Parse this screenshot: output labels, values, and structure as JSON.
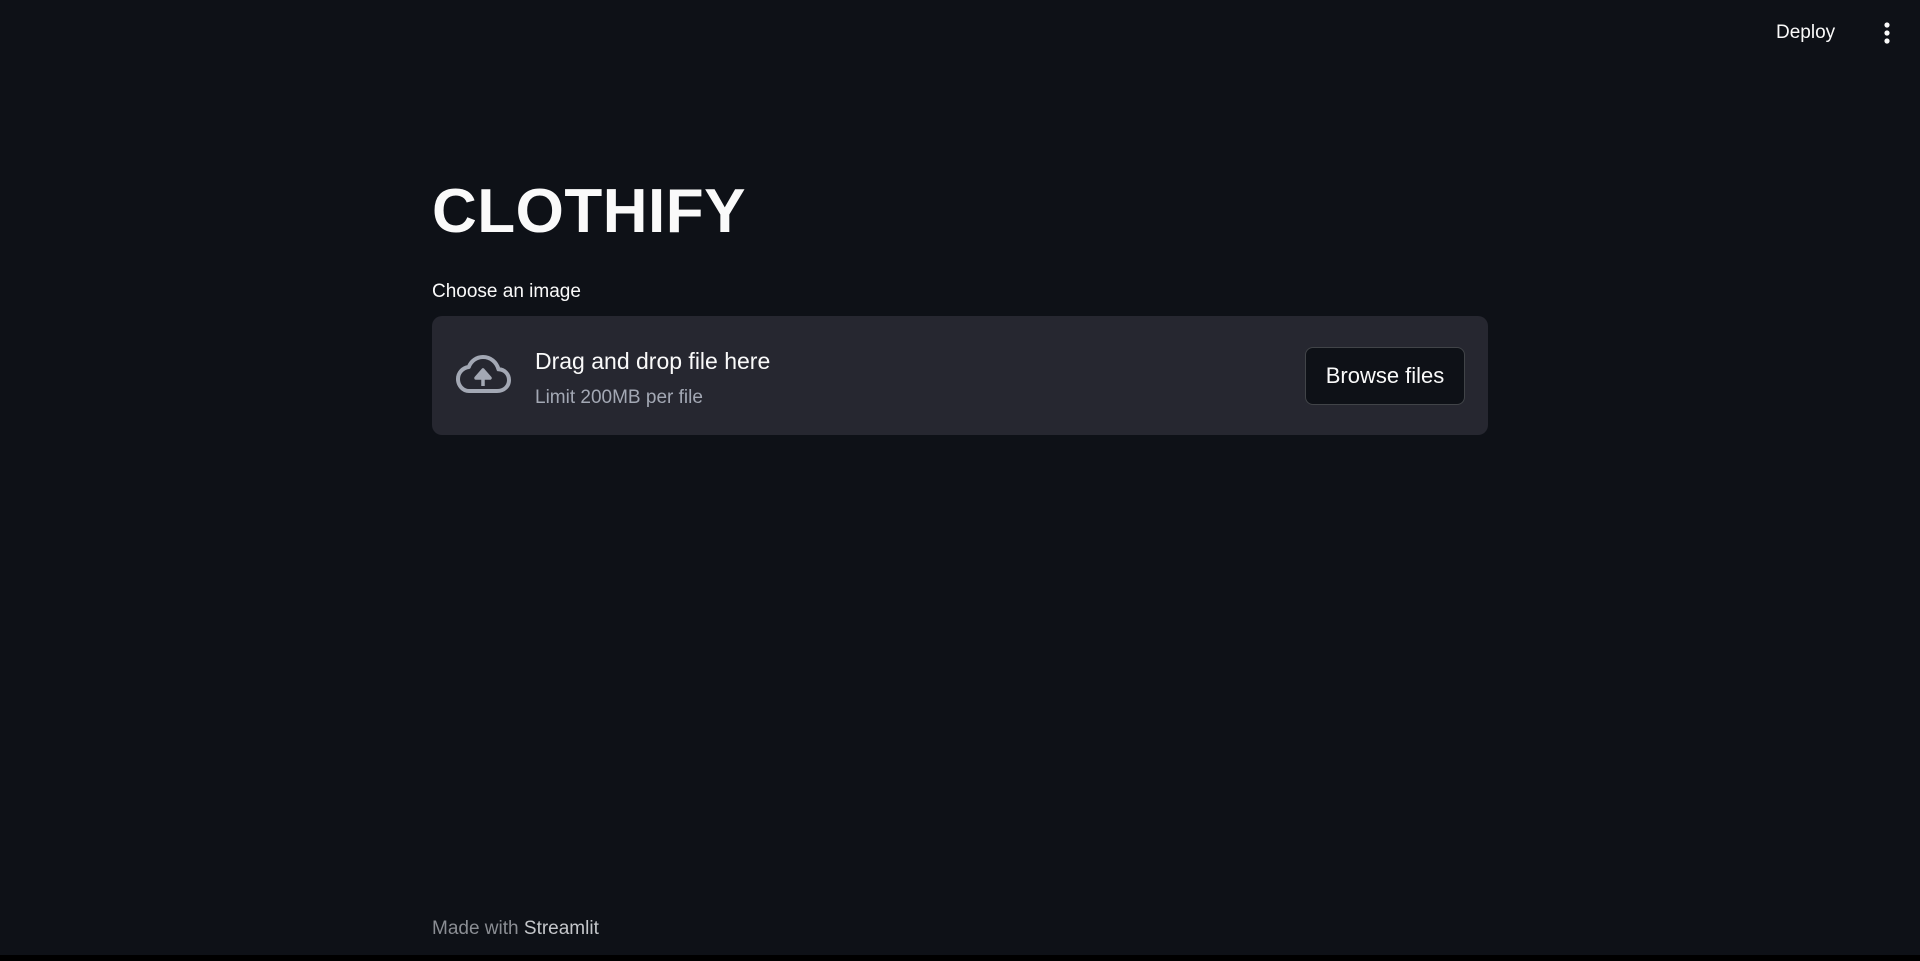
{
  "header": {
    "deploy_label": "Deploy",
    "menu_icon": "vertical-dots-icon"
  },
  "main": {
    "title": "CLOTHIFY",
    "uploader": {
      "label": "Choose an image",
      "icon": "cloud-upload-icon",
      "drop_text": "Drag and drop file here",
      "limit_text": "Limit 200MB per file",
      "browse_label": "Browse files"
    }
  },
  "footer": {
    "made_with": "Made with",
    "brand": "Streamlit"
  },
  "colors": {
    "background": "#0e1117",
    "dropzone": "#262730",
    "text": "#fafafa",
    "muted_text": "#a3a8b4"
  }
}
